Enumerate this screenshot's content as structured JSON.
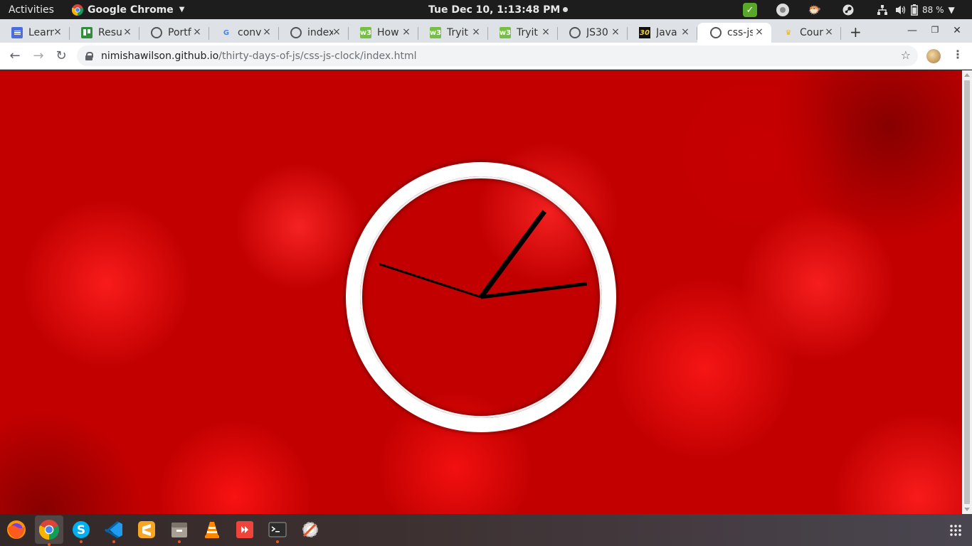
{
  "topbar": {
    "activities": "Activities",
    "app_name": "Google Chrome",
    "clock": "Tue Dec 10,  1:13:48 PM",
    "battery": "88 %"
  },
  "tabs": [
    {
      "label": "Learn",
      "favicon": "docs-icon"
    },
    {
      "label": "Resu",
      "favicon": "trello-icon"
    },
    {
      "label": "Portf",
      "favicon": "globe-icon"
    },
    {
      "label": "conv",
      "favicon": "google-icon"
    },
    {
      "label": "index",
      "favicon": "globe-icon"
    },
    {
      "label": "How",
      "favicon": "w3schools-icon"
    },
    {
      "label": "Tryit",
      "favicon": "w3schools-icon"
    },
    {
      "label": "Tryit",
      "favicon": "w3schools-icon"
    },
    {
      "label": "JS30",
      "favicon": "globe-icon"
    },
    {
      "label": "Java",
      "favicon": "js30-icon"
    },
    {
      "label": "css-js",
      "favicon": "globe-icon",
      "active": true
    },
    {
      "label": "Cour",
      "favicon": "crown-icon"
    }
  ],
  "omnibox": {
    "host": "nimishawilson.github.io",
    "path": "/thirty-days-of-js/css-js-clock/index.html"
  },
  "clock_face": {
    "time": "1:13:48",
    "colors": {
      "rim": "#ffffff",
      "hands": "#000000"
    }
  },
  "dock": {
    "apps": [
      "firefox-icon",
      "chrome-icon",
      "skype-icon",
      "vscode-icon",
      "sublime-icon",
      "files-icon",
      "vlc-icon",
      "anydesk-icon",
      "terminal-icon",
      "software-updater-icon"
    ],
    "running": [
      "chrome-icon",
      "skype-icon",
      "vscode-icon",
      "files-icon",
      "terminal-icon"
    ]
  },
  "colors": {
    "page_background": "#c20000",
    "accent": "#e95420"
  }
}
